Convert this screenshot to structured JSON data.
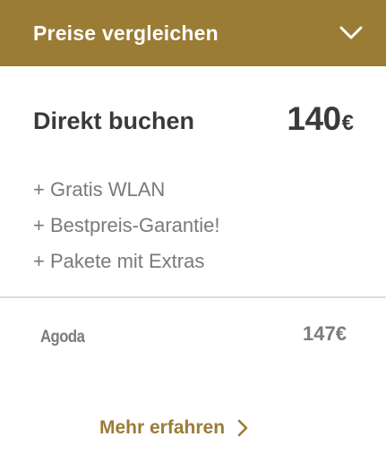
{
  "header": {
    "title": "Preise vergleichen",
    "toggle_icon": "chevron-down-icon"
  },
  "direct_booking": {
    "label": "Direkt buchen",
    "price_amount": "140",
    "price_currency": "€"
  },
  "features": [
    "+ Gratis WLAN",
    "+ Bestpreis-Garantie!",
    "+ Pakete mit Extras"
  ],
  "providers": [
    {
      "name": "Agoda",
      "price": "147€"
    }
  ],
  "more_link": {
    "label": "Mehr erfahren",
    "icon": "chevron-right-icon"
  },
  "colors": {
    "accent": "#9b7c35",
    "text_dark": "#3a3a3a",
    "text_muted": "#7a7a7a",
    "divider": "#dddddd"
  }
}
